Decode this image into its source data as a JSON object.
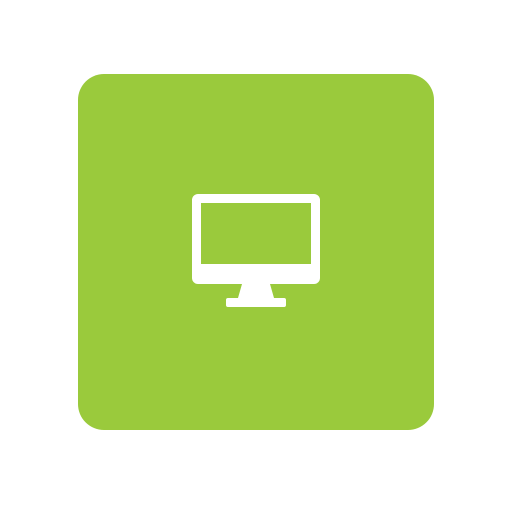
{
  "tile": {
    "color": "#9aca3c",
    "icon": "monitor-icon",
    "icon_color": "#ffffff"
  }
}
